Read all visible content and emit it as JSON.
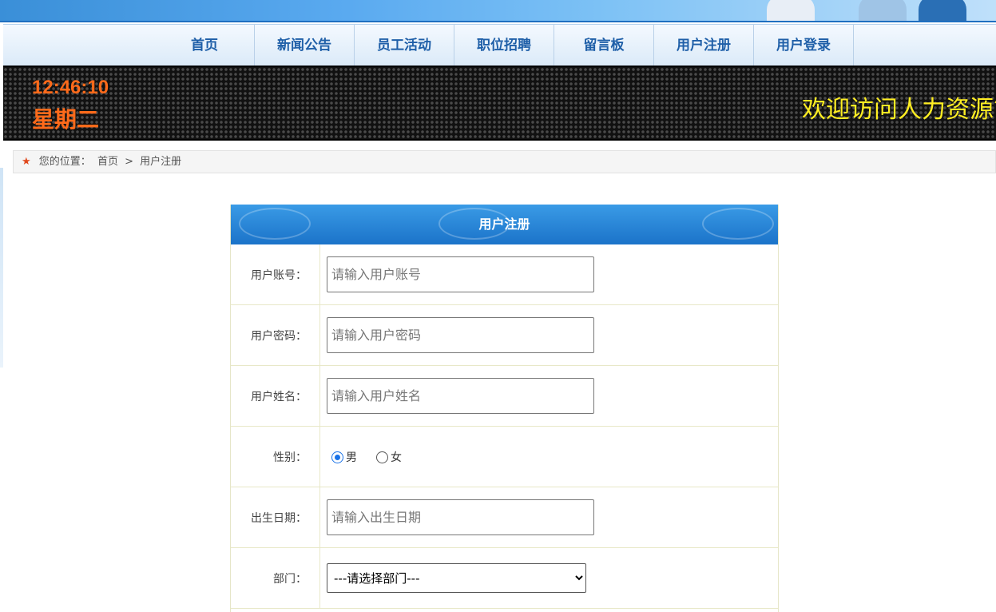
{
  "nav": {
    "items": [
      "首页",
      "新闻公告",
      "员工活动",
      "职位招聘",
      "留言板",
      "用户注册",
      "用户登录"
    ]
  },
  "led": {
    "time": "12:46:10",
    "weekday": "星期二",
    "marquee": "欢迎访问人力资源管"
  },
  "breadcrumb": {
    "prefix": "您的位置：",
    "home": "首页",
    "separator": ">",
    "current": "用户注册"
  },
  "form": {
    "title": "用户注册",
    "account_label": "用户账号：",
    "account_placeholder": "请输入用户账号",
    "password_label": "用户密码：",
    "password_placeholder": "请输入用户密码",
    "name_label": "用户姓名：",
    "name_placeholder": "请输入用户姓名",
    "gender_label": "性别：",
    "gender_male": "男",
    "gender_female": "女",
    "gender_selected": "男",
    "birthday_label": "出生日期：",
    "birthday_placeholder": "请输入出生日期",
    "department_label": "部门：",
    "department_selected": "---请选择部门---"
  },
  "colors": {
    "nav_text": "#1f5fa8",
    "led_time": "#ff6a1a",
    "led_marquee": "#ffee22",
    "header_blue": "#1b73c9"
  }
}
